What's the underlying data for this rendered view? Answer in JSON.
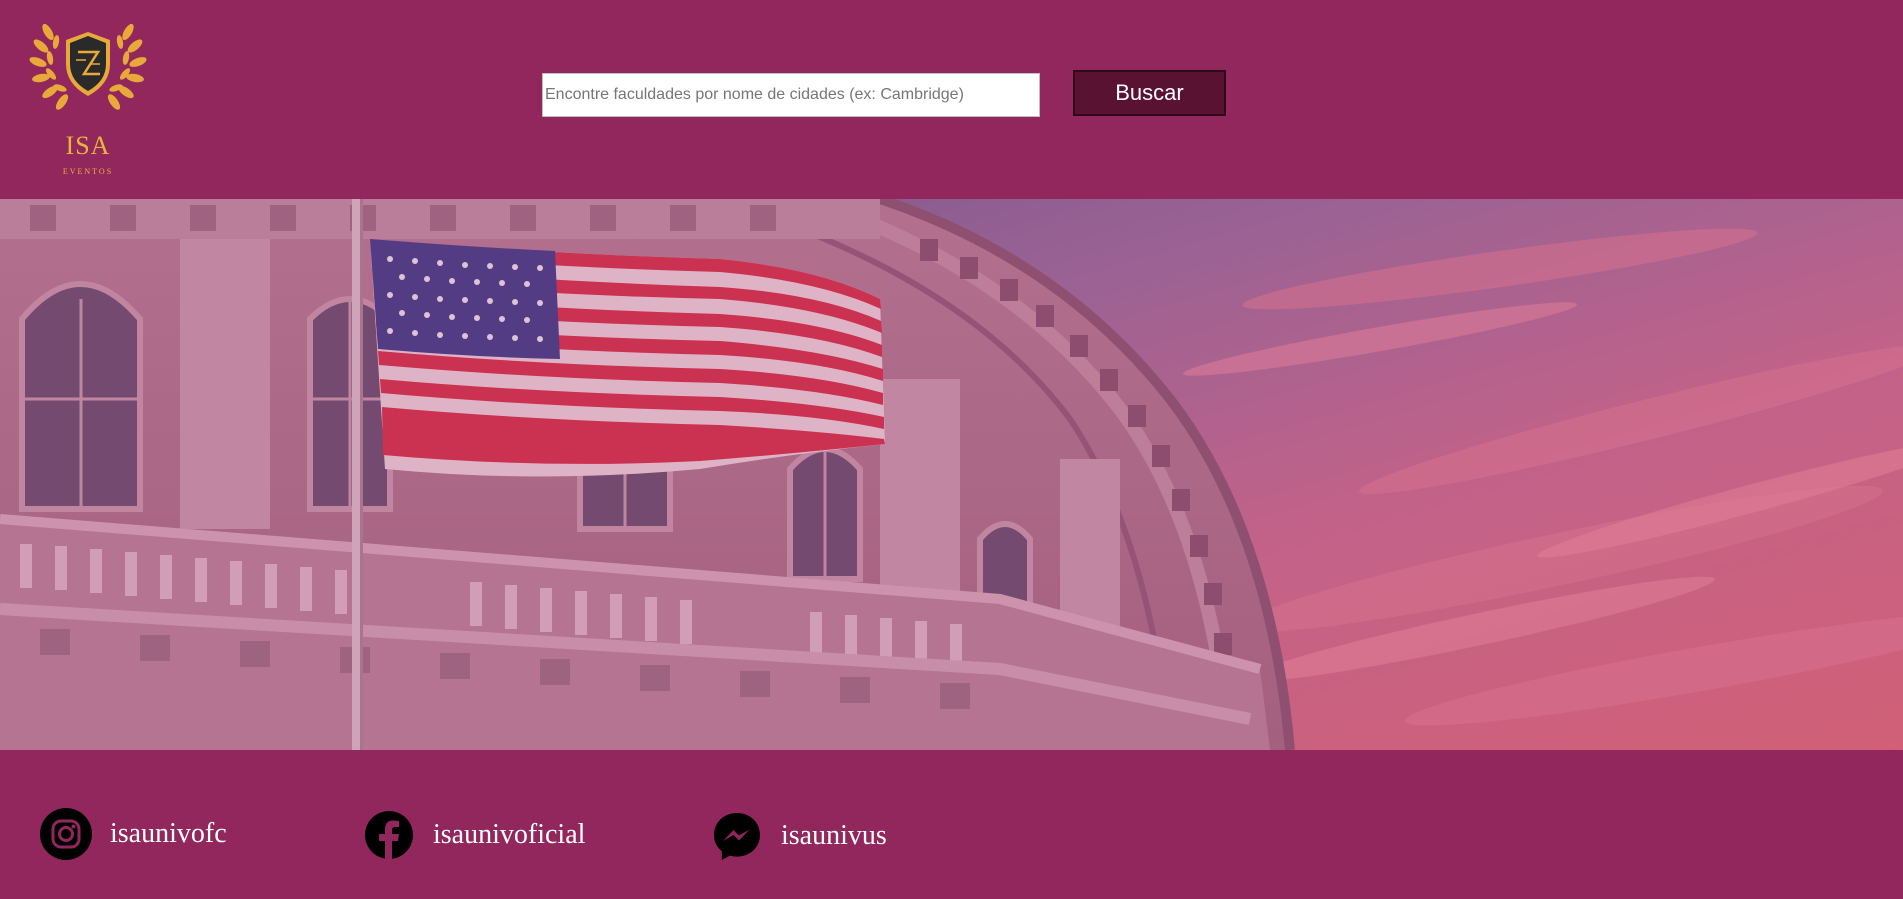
{
  "brand": {
    "name": "ISA",
    "tagline": "EVENTOS",
    "gold": "#e8b43a"
  },
  "search": {
    "value": "",
    "placeholder": "Encontre faculdades por nome de cidades (ex: Cambridge)",
    "button_label": "Buscar"
  },
  "hero": {
    "icon": "capitol-building-with-american-flag-image"
  },
  "social": [
    {
      "icon": "instagram-icon",
      "handle": "isaunivofc"
    },
    {
      "icon": "facebook-icon",
      "handle": "isaunivoficial"
    },
    {
      "icon": "messenger-icon",
      "handle": "isaunivus"
    }
  ],
  "colors": {
    "background": "#91275c",
    "button": "#5a1233",
    "text_light": "#ffffff"
  }
}
